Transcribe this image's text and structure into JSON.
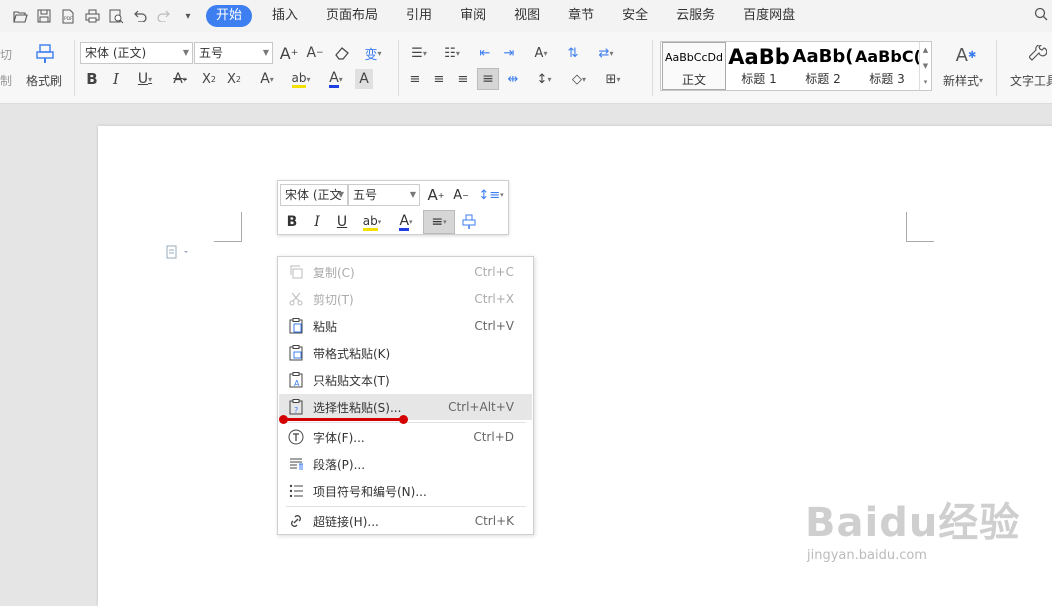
{
  "menubar": {
    "tabs": [
      "开始",
      "插入",
      "页面布局",
      "引用",
      "审阅",
      "视图",
      "章节",
      "安全",
      "云服务",
      "百度网盘"
    ]
  },
  "ribbon": {
    "clipboard": {
      "cut": "剪切",
      "copy": "复制",
      "format_painter": "格式刷"
    },
    "font_name": "宋体 (正文)",
    "font_size": "五号",
    "styles": [
      {
        "preview": "AaBbCcDd",
        "label": "正文"
      },
      {
        "preview": "AaBb",
        "label": "标题 1"
      },
      {
        "preview": "AaBb(",
        "label": "标题 2"
      },
      {
        "preview": "AaBbC(",
        "label": "标题 3"
      }
    ],
    "new_style": "新样式",
    "text_tools": "文字工具"
  },
  "minitoolbar": {
    "font_name": "宋体 (正文",
    "font_size": "五号"
  },
  "context_menu": {
    "items": [
      {
        "label": "复制(C)",
        "shortcut": "Ctrl+C",
        "icon": "copy-icon",
        "disabled": true
      },
      {
        "label": "剪切(T)",
        "shortcut": "Ctrl+X",
        "icon": "scissors-icon",
        "disabled": true
      },
      {
        "label": "粘贴",
        "shortcut": "Ctrl+V",
        "icon": "paste-icon",
        "disabled": false
      },
      {
        "label": "带格式粘贴(K)",
        "shortcut": "",
        "icon": "paste-format-icon",
        "disabled": false
      },
      {
        "label": "只粘贴文本(T)",
        "shortcut": "",
        "icon": "paste-text-icon",
        "disabled": false
      },
      {
        "label": "选择性粘贴(S)...",
        "shortcut": "Ctrl+Alt+V",
        "icon": "paste-special-icon",
        "disabled": false
      },
      {
        "label": "字体(F)...",
        "shortcut": "Ctrl+D",
        "icon": "font-icon",
        "disabled": false
      },
      {
        "label": "段落(P)...",
        "shortcut": "",
        "icon": "paragraph-icon",
        "disabled": false
      },
      {
        "label": "项目符号和编号(N)...",
        "shortcut": "",
        "icon": "list-icon",
        "disabled": false
      },
      {
        "label": "超链接(H)...",
        "shortcut": "Ctrl+K",
        "icon": "link-icon",
        "disabled": false
      }
    ]
  },
  "watermark": {
    "brand": "Baidu经验",
    "url": "jingyan.baidu.com"
  },
  "colors": {
    "accent": "#3d7ef0",
    "annotation": "#d40000"
  }
}
